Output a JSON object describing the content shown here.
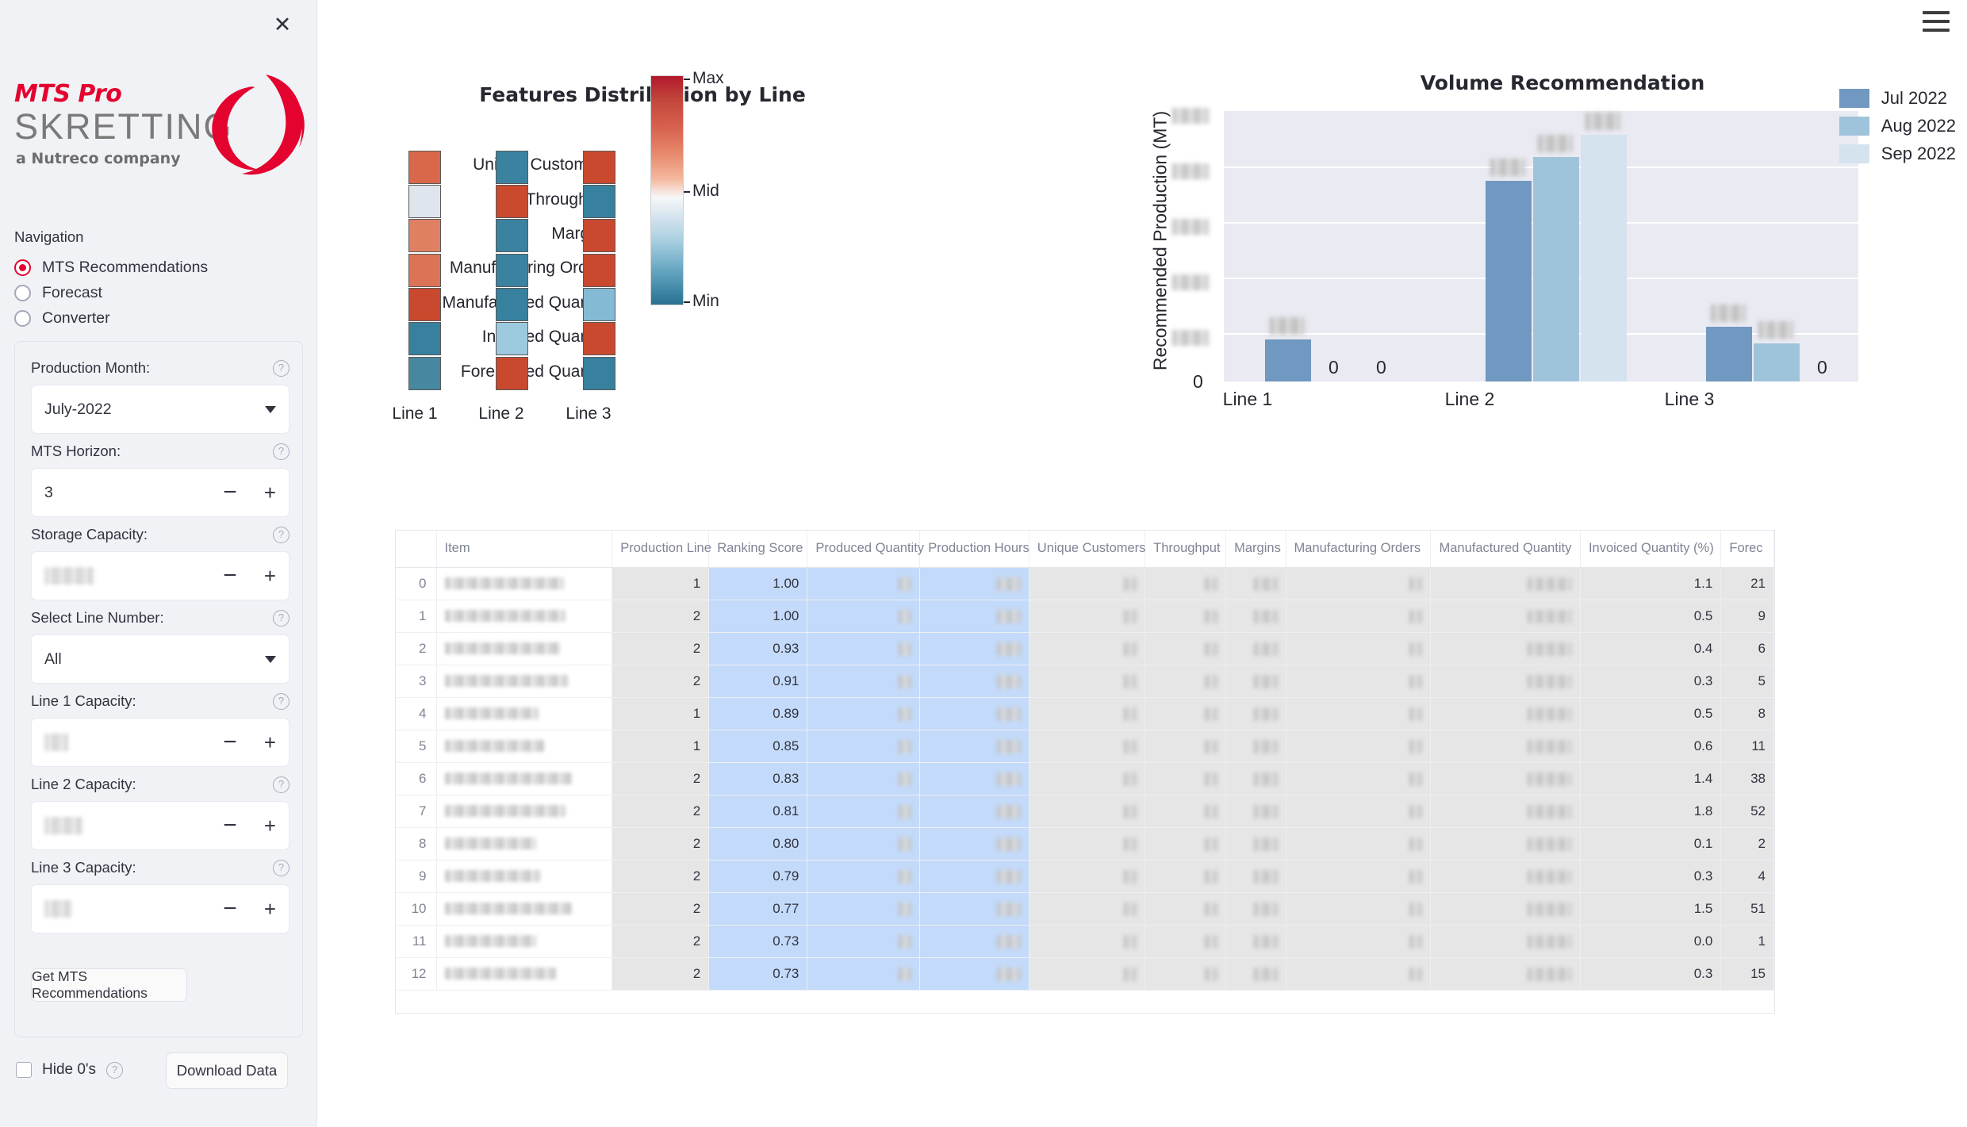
{
  "sidebar": {
    "close_icon": "close-icon",
    "logo": {
      "product": "MTS Pro",
      "brand": "SKRETTING",
      "tagline": "a Nutreco company"
    },
    "nav_heading": "Navigation",
    "nav_items": [
      {
        "label": "MTS Recommendations",
        "selected": true
      },
      {
        "label": "Forecast",
        "selected": false
      },
      {
        "label": "Converter",
        "selected": false
      }
    ],
    "fields": [
      {
        "label": "Production Month:",
        "value": "July-2022",
        "type": "select",
        "help": "?"
      },
      {
        "label": "MTS Horizon:",
        "value": "3",
        "type": "stepper",
        "help": "?"
      },
      {
        "label": "Storage Capacity:",
        "value": "",
        "type": "stepper",
        "help": "?"
      },
      {
        "label": "Select Line Number:",
        "value": "All",
        "type": "select",
        "help": "?"
      },
      {
        "label": "Line 1 Capacity:",
        "value": "",
        "type": "stepper",
        "help": "?"
      },
      {
        "label": "Line 2 Capacity:",
        "value": "",
        "type": "stepper",
        "help": "?"
      },
      {
        "label": "Line 3 Capacity:",
        "value": "",
        "type": "stepper",
        "help": "?"
      }
    ],
    "stepper_minus": "−",
    "stepper_plus": "+",
    "get_recommendations_label": "Get MTS Recommendations",
    "hide_zeros_label": "Hide 0's",
    "hide_zeros_help": "?",
    "download_label": "Download Data"
  },
  "topbar": {
    "menu_icon": "hamburger-menu-icon"
  },
  "chart_data": [
    {
      "type": "heatmap",
      "title": "Features Distribution by Line",
      "xlabel": "",
      "ylabel": "",
      "categories": [
        "Line 1",
        "Line 2",
        "Line 3"
      ],
      "rows": [
        "Unique Customers",
        "Throughput",
        "Margins",
        "Manufacturing Orders",
        "Manufactured Quantity",
        "Invoiced Quantity",
        "Forecasted Quantity"
      ],
      "cell_colors": [
        [
          "#d9684b",
          "#3b82a0",
          "#c9492f"
        ],
        [
          "#dfe5ec",
          "#ca4a2e",
          "#37809e"
        ],
        [
          "#df8063",
          "#3b82a0",
          "#c9492f"
        ],
        [
          "#dd7356",
          "#3b82a0",
          "#c9492f"
        ],
        [
          "#c9492f",
          "#37809e",
          "#84bad3"
        ],
        [
          "#37809e",
          "#9dc9de",
          "#c9492f"
        ],
        [
          "#46889f",
          "#c9492f",
          "#37809e"
        ]
      ],
      "colorbar": {
        "max_label": "Max",
        "mid_label": "Mid",
        "min_label": "Min"
      }
    },
    {
      "type": "bar",
      "title": "Volume Recommendation",
      "ylabel": "Recommended Production (MT)",
      "xlabel": "",
      "categories": [
        "Line 1",
        "Line 2",
        "Line 3"
      ],
      "legend_position": "top-right",
      "series": [
        {
          "name": "Jul 2022",
          "color": "#7098c0",
          "values": [
            72,
            341,
            93
          ]
        },
        {
          "name": "Aug 2022",
          "color": "#a0c3dc",
          "values": [
            0,
            382,
            65
          ]
        },
        {
          "name": "Sep 2022",
          "color": "#d4e3ee",
          "values": [
            0,
            419,
            0
          ]
        }
      ],
      "zero_labels": [
        "0",
        "0",
        "0"
      ],
      "y_zero_tick": "0",
      "ytick_count": 5,
      "grid": true
    }
  ],
  "table": {
    "columns": [
      "",
      "Item",
      "Production Line",
      "Ranking Score",
      "Produced Quantity",
      "Production Hours",
      "Unique Customers",
      "Throughput",
      "Margins",
      "Manufacturing Orders",
      "Manufactured Quantity",
      "Invoiced Quantity (%)",
      "Forec"
    ],
    "rows": [
      {
        "idx": "0",
        "production_line": "1",
        "ranking_score": "1.00",
        "invoiced_pct": "1.1",
        "forecast": "21"
      },
      {
        "idx": "1",
        "production_line": "2",
        "ranking_score": "1.00",
        "invoiced_pct": "0.5",
        "forecast": "9"
      },
      {
        "idx": "2",
        "production_line": "2",
        "ranking_score": "0.93",
        "invoiced_pct": "0.4",
        "forecast": "6"
      },
      {
        "idx": "3",
        "production_line": "2",
        "ranking_score": "0.91",
        "invoiced_pct": "0.3",
        "forecast": "5"
      },
      {
        "idx": "4",
        "production_line": "1",
        "ranking_score": "0.89",
        "invoiced_pct": "0.5",
        "forecast": "8"
      },
      {
        "idx": "5",
        "production_line": "1",
        "ranking_score": "0.85",
        "invoiced_pct": "0.6",
        "forecast": "11"
      },
      {
        "idx": "6",
        "production_line": "2",
        "ranking_score": "0.83",
        "invoiced_pct": "1.4",
        "forecast": "38"
      },
      {
        "idx": "7",
        "production_line": "2",
        "ranking_score": "0.81",
        "invoiced_pct": "1.8",
        "forecast": "52"
      },
      {
        "idx": "8",
        "production_line": "2",
        "ranking_score": "0.80",
        "invoiced_pct": "0.1",
        "forecast": "2"
      },
      {
        "idx": "9",
        "production_line": "2",
        "ranking_score": "0.79",
        "invoiced_pct": "0.3",
        "forecast": "4"
      },
      {
        "idx": "10",
        "production_line": "2",
        "ranking_score": "0.77",
        "invoiced_pct": "1.5",
        "forecast": "51"
      },
      {
        "idx": "11",
        "production_line": "2",
        "ranking_score": "0.73",
        "invoiced_pct": "0.0",
        "forecast": "1"
      },
      {
        "idx": "12",
        "production_line": "2",
        "ranking_score": "0.73",
        "invoiced_pct": "0.3",
        "forecast": "15"
      }
    ]
  }
}
